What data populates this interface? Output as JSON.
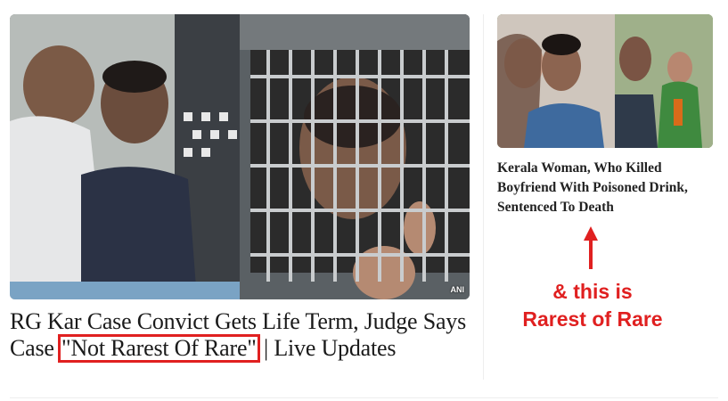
{
  "main_story": {
    "image_alt": "RG Kar convict in police van",
    "image_credit": "ANI",
    "headline_part1": "RG Kar Case Convict Gets Life Term, Judge Says Case ",
    "headline_highlight": "\"Not Rarest Of Rare\"",
    "headline_part2": " | Live Updates"
  },
  "side_story": {
    "image_alt": "Kerala woman and boyfriend",
    "image_credit": "",
    "headline": "Kerala Woman, Who Killed Boyfriend With Poisoned Drink, Sentenced To Death"
  },
  "annotation": {
    "line1": "& this is",
    "line2": "Rarest of Rare",
    "color": "#e02020"
  }
}
